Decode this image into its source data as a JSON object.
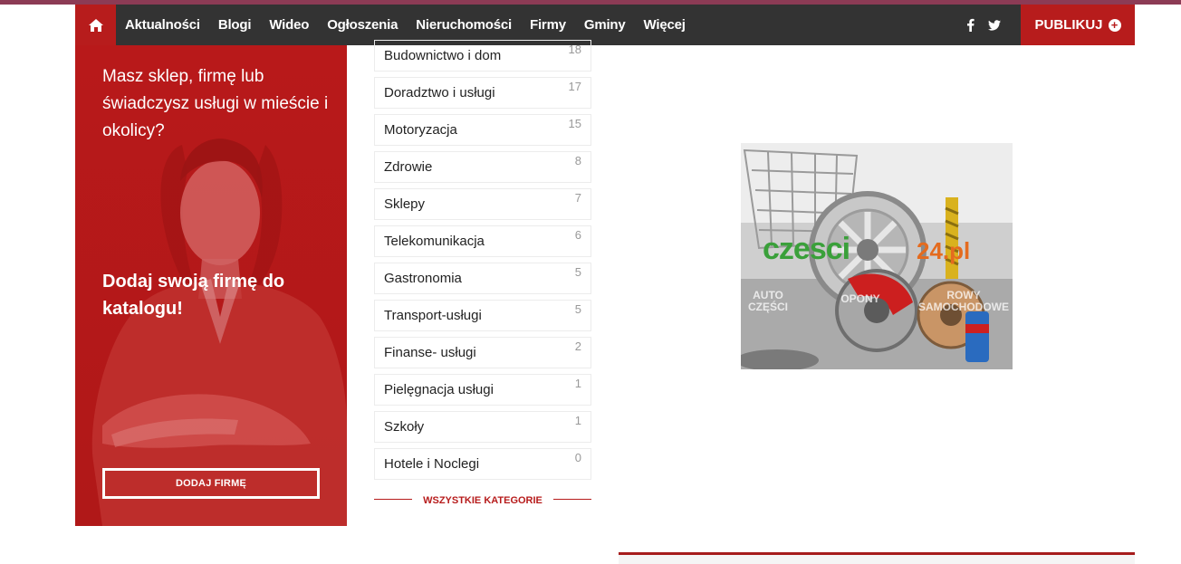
{
  "colors": {
    "brand_red": "#b71c1c",
    "navbar": "#333333",
    "top_stripe": "#8c3b55"
  },
  "nav": {
    "home_icon": "home-icon",
    "items": [
      "Aktualności",
      "Blogi",
      "Wideo",
      "Ogłoszenia",
      "Nieruchomości",
      "Firmy",
      "Gminy",
      "Więcej"
    ],
    "social": [
      "facebook-icon",
      "twitter-icon"
    ],
    "publish_label": "PUBLIKUJ"
  },
  "promo": {
    "text": "Masz sklep, firmę lub świadczysz usługi w mieście i okolicy?",
    "cta_text": "Dodaj swoją firmę do katalogu!",
    "button": "DODAJ FIRMĘ"
  },
  "categories": [
    {
      "name": "Budownictwo i dom",
      "count": "18"
    },
    {
      "name": "Doradztwo i usługi",
      "count": "17"
    },
    {
      "name": "Motoryzacja",
      "count": "15"
    },
    {
      "name": "Zdrowie",
      "count": "8"
    },
    {
      "name": "Sklepy",
      "count": "7"
    },
    {
      "name": "Telekomunikacja",
      "count": "6"
    },
    {
      "name": "Gastronomia",
      "count": "5"
    },
    {
      "name": "Transport-usługi",
      "count": "5"
    },
    {
      "name": "Finanse- usługi",
      "count": "2"
    },
    {
      "name": "Pielęgnacja usługi",
      "count": "1"
    },
    {
      "name": "Szkoły",
      "count": "1"
    },
    {
      "name": "Hotele i Noclegi",
      "count": "0"
    }
  ],
  "all_categories_label": "WSZYSTKIE KATEGORIE",
  "ad": {
    "brand": "czesci",
    "brand_tld": "24.pl",
    "labels": [
      "AUTO CZĘŚCI",
      "OPONY",
      "ROWY SAMOCHODOWE"
    ]
  }
}
